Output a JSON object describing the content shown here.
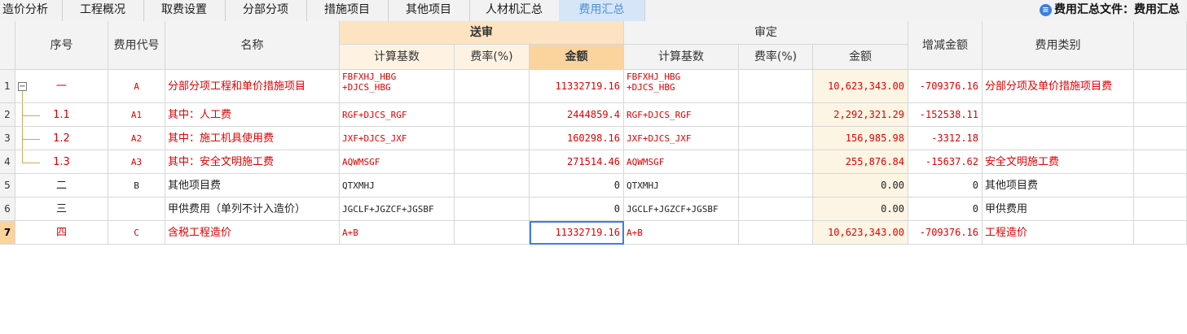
{
  "tabs": [
    "造价分析",
    "工程概况",
    "取费设置",
    "分部分项",
    "措施项目",
    "其他项目",
    "人材机汇总",
    "费用汇总"
  ],
  "active_tab": "费用汇总",
  "file_info": "费用汇总文件：费用汇总",
  "header": {
    "seq": "序号",
    "code": "费用代号",
    "name": "名称",
    "sent_group": "送审",
    "review_group": "审定",
    "calc_base": "计算基数",
    "rate": "费率(%)",
    "amount_sent": "金额",
    "amount_review": "金额",
    "diff": "增减金额",
    "category": "费用类别"
  },
  "rows": [
    {
      "idx": "1",
      "seq": "一",
      "code": "A",
      "name": "分部分项工程和单价措施项目",
      "base_sent": [
        "FBFXHJ_HBG",
        "+DJCS_HBG"
      ],
      "rate_sent": "",
      "amount_sent": "11332719.16",
      "base_review": [
        "FBFXHJ_HBG",
        "+DJCS_HBG"
      ],
      "rate_review": "",
      "amount_review": "10,623,343.00",
      "diff": "-709376.16",
      "category": "分部分项及单价措施项目费",
      "red": true
    },
    {
      "idx": "2",
      "seq": "1.1",
      "code": "A1",
      "name": "其中：人工费",
      "base_sent": [
        "RGF+DJCS_RGF"
      ],
      "rate_sent": "",
      "amount_sent": "2444859.4",
      "base_review": [
        "RGF+DJCS_RGF"
      ],
      "rate_review": "",
      "amount_review": "2,292,321.29",
      "diff": "-152538.11",
      "category": "",
      "red": true
    },
    {
      "idx": "3",
      "seq": "1.2",
      "code": "A2",
      "name": "其中：施工机具使用费",
      "base_sent": [
        "JXF+DJCS_JXF"
      ],
      "rate_sent": "",
      "amount_sent": "160298.16",
      "base_review": [
        "JXF+DJCS_JXF"
      ],
      "rate_review": "",
      "amount_review": "156,985.98",
      "diff": "-3312.18",
      "category": "",
      "red": true
    },
    {
      "idx": "4",
      "seq": "1.3",
      "code": "A3",
      "name": "其中：安全文明施工费",
      "base_sent": [
        "AQWMSGF"
      ],
      "rate_sent": "",
      "amount_sent": "271514.46",
      "base_review": [
        "AQWMSGF"
      ],
      "rate_review": "",
      "amount_review": "255,876.84",
      "diff": "-15637.62",
      "category": "安全文明施工费",
      "red": true
    },
    {
      "idx": "5",
      "seq": "二",
      "code": "B",
      "name": "其他项目费",
      "base_sent": [
        "QTXMHJ"
      ],
      "rate_sent": "",
      "amount_sent": "0",
      "base_review": [
        "QTXMHJ"
      ],
      "rate_review": "",
      "amount_review": "0.00",
      "diff": "0",
      "category": "其他项目费",
      "red": false
    },
    {
      "idx": "6",
      "seq": "三",
      "code": "",
      "name": "甲供费用（单列不计入造价）",
      "base_sent": [
        "JGCLF+JGZCF+JGSBF"
      ],
      "rate_sent": "",
      "amount_sent": "0",
      "base_review": [
        "JGCLF+JGZCF+JGSBF"
      ],
      "rate_review": "",
      "amount_review": "0.00",
      "diff": "0",
      "category": "甲供费用",
      "red": false
    },
    {
      "idx": "7",
      "seq": "四",
      "code": "C",
      "name": "含税工程造价",
      "base_sent": [
        "A+B"
      ],
      "rate_sent": "",
      "amount_sent": "11332719.16",
      "base_review": [
        "A+B"
      ],
      "rate_review": "",
      "amount_review": "10,623,343.00",
      "diff": "-709376.16",
      "category": "工程造价",
      "red": true
    }
  ],
  "colors": {
    "accent": "#3d7fe0",
    "red_text": "#e00000",
    "sent_header": "#fde3c1",
    "review_amount_bg": "#fdf5e4"
  }
}
